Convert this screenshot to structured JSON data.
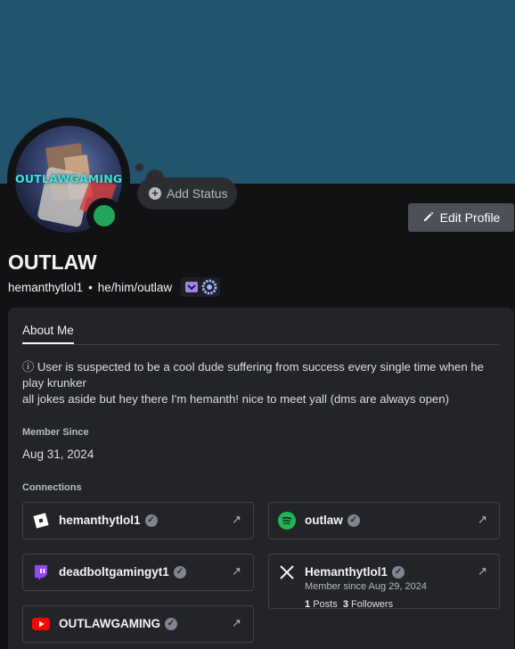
{
  "colors": {
    "banner": "#22536f",
    "online": "#23a559",
    "nitro": "#a87cff"
  },
  "avatar": {
    "text": "OUTLAWGAMING",
    "status": "online"
  },
  "status_bubble": {
    "label": "Add Status"
  },
  "edit_profile": {
    "label": "Edit Profile"
  },
  "profile": {
    "display_name": "OUTLAW",
    "username": "hemanthytlol1",
    "separator": "•",
    "pronouns": "he/him/outlaw",
    "badges": [
      "hypesquad-icon",
      "active-developer-icon"
    ]
  },
  "tabs": {
    "about_me": "About Me"
  },
  "bio": {
    "line1": "ⓘ User is suspected to be a cool dude suffering from success every single time when he play krunker",
    "line2": "all jokes aside but hey there I'm hemanth! nice to meet yall (dms are always open)"
  },
  "member_since": {
    "heading": "Member Since",
    "date": "Aug 31, 2024"
  },
  "connections": {
    "heading": "Connections",
    "items": [
      {
        "name": "hemanthytlol1",
        "icon": "roblox-icon"
      },
      {
        "name": "outlaw",
        "icon": "spotify-icon"
      },
      {
        "name": "deadboltgamingyt1",
        "icon": "twitch-icon"
      },
      {
        "name": "Hemanthytlol1",
        "icon": "x-icon",
        "sub": "Member since Aug 29, 2024",
        "posts": "1",
        "posts_label": "Posts",
        "followers": "3",
        "followers_label": "Followers"
      },
      {
        "name": "OUTLAWGAMING",
        "icon": "youtube-icon"
      }
    ]
  }
}
